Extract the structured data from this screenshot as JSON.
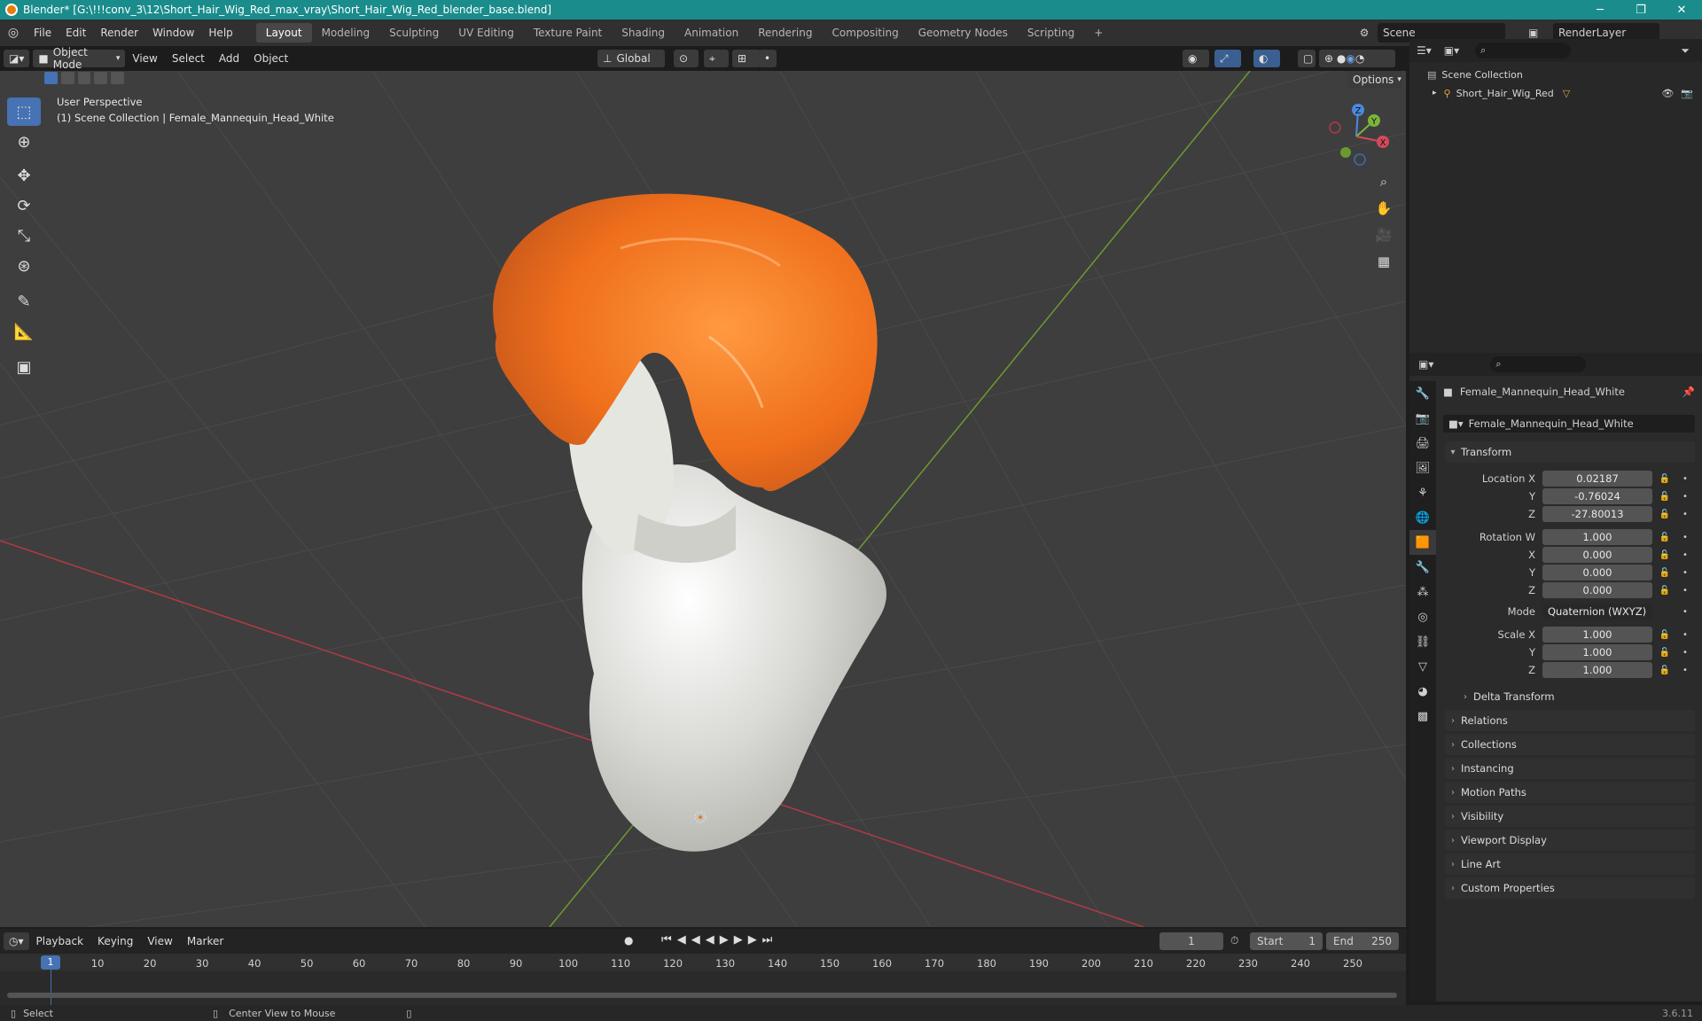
{
  "window": {
    "title": "Blender* [G:\\!!!conv_3\\12\\Short_Hair_Wig_Red_max_vray\\Short_Hair_Wig_Red_blender_base.blend]",
    "minimize": "─",
    "maximize": "❐",
    "close": "✕"
  },
  "menus": [
    "File",
    "Edit",
    "Render",
    "Window",
    "Help"
  ],
  "workspaces": [
    "Layout",
    "Modeling",
    "Sculpting",
    "UV Editing",
    "Texture Paint",
    "Shading",
    "Animation",
    "Rendering",
    "Compositing",
    "Geometry Nodes",
    "Scripting",
    "+"
  ],
  "scene": {
    "name": "Scene",
    "view_layer": "RenderLayer"
  },
  "viewport_header": {
    "mode": "Object Mode",
    "menus": [
      "View",
      "Select",
      "Add",
      "Object"
    ],
    "orientation": "Global",
    "options": "Options"
  },
  "viewport": {
    "perspective": "User Perspective",
    "context": "(1) Scene Collection | Female_Mannequin_Head_White",
    "gizmo": {
      "x": "X",
      "y": "Y",
      "z": "Z"
    }
  },
  "outliner": {
    "root": "Scene Collection",
    "items": [
      {
        "name": "Short_Hair_Wig_Red"
      }
    ]
  },
  "properties": {
    "object_header": "Female_Mannequin_Head_White",
    "object_name": "Female_Mannequin_Head_White",
    "transform_title": "Transform",
    "location": {
      "label": "Location X",
      "x": "0.02187",
      "y": "-0.76024",
      "z": "-27.80013"
    },
    "rotation": {
      "label": "Rotation W",
      "w": "1.000",
      "x": "0.000",
      "y": "0.000",
      "z": "0.000"
    },
    "mode": {
      "label": "Mode",
      "value": "Quaternion (WXYZ)"
    },
    "scale": {
      "label": "Scale X",
      "x": "1.000",
      "y": "1.000",
      "z": "1.000"
    },
    "axis_labels": {
      "y": "Y",
      "z": "Z",
      "x": "X"
    },
    "delta": "Delta Transform",
    "panels": [
      "Relations",
      "Collections",
      "Instancing",
      "Motion Paths",
      "Visibility",
      "Viewport Display",
      "Line Art",
      "Custom Properties"
    ]
  },
  "timeline": {
    "menus": [
      "Playback",
      "Keying",
      "View",
      "Marker"
    ],
    "current_frame": "1",
    "start_label": "Start",
    "start": "1",
    "end_label": "End",
    "end": "250",
    "ticks": [
      "1",
      "10",
      "20",
      "30",
      "40",
      "50",
      "60",
      "70",
      "80",
      "90",
      "100",
      "110",
      "120",
      "130",
      "140",
      "150",
      "160",
      "170",
      "180",
      "190",
      "200",
      "210",
      "220",
      "230",
      "240",
      "250"
    ]
  },
  "statusbar": {
    "select": "Select",
    "center": "Center View to Mouse",
    "version": "3.6.11"
  }
}
